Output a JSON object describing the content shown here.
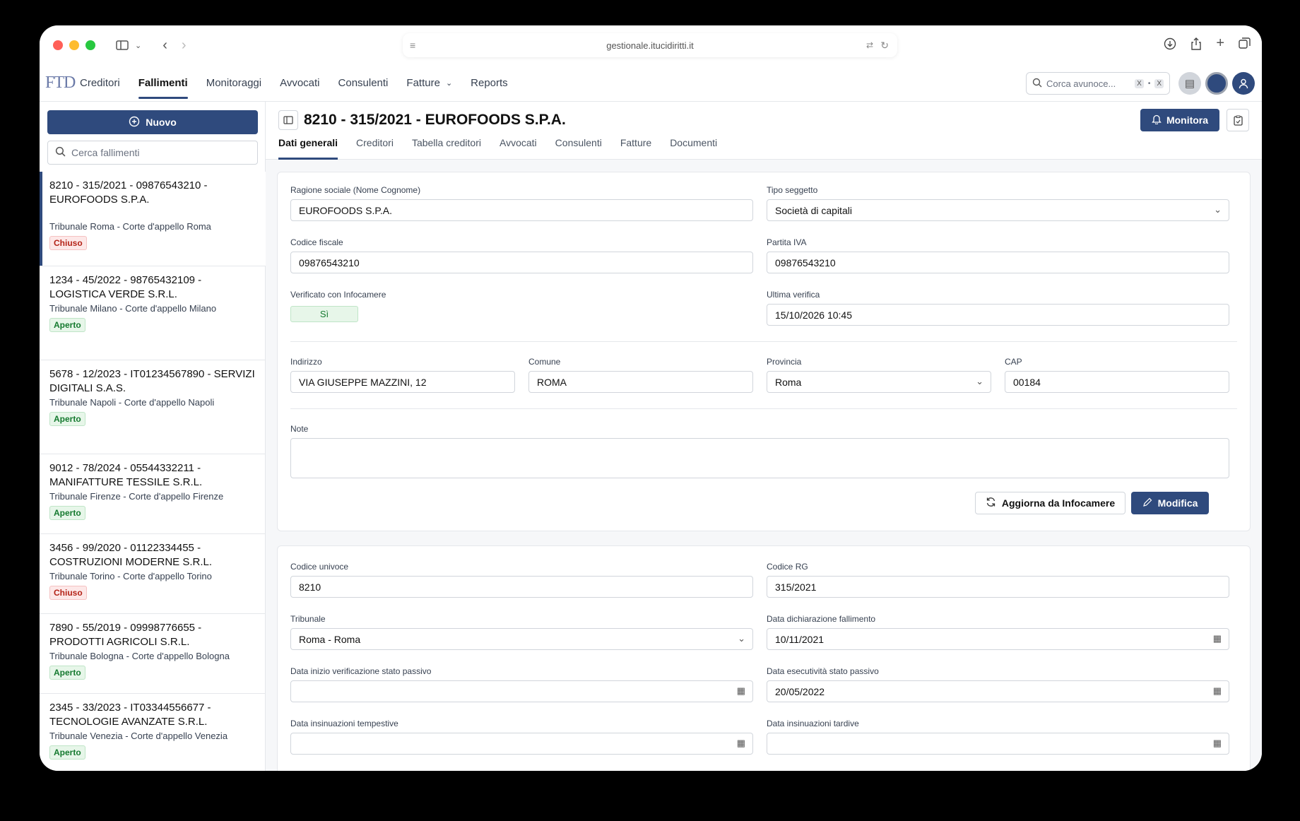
{
  "browser": {
    "url": "gestionale.itucidiritti.it"
  },
  "app": {
    "logo": "FTD",
    "nav": [
      {
        "label": "Creditori"
      },
      {
        "label": "Fallimenti"
      },
      {
        "label": "Monitoraggi"
      },
      {
        "label": "Avvocati"
      },
      {
        "label": "Consulenti"
      },
      {
        "label": "Fatture"
      },
      {
        "label": "Reports"
      }
    ],
    "search_placeholder": "Corca avunoce...",
    "search_kbd1": "X",
    "search_kbd_sep": "•",
    "search_kbd2": "X",
    "accent_color": "#2f4a7d"
  },
  "sidebar": {
    "new_button": "Nuovo",
    "search_placeholder": "Cerca fallimenti",
    "items": [
      {
        "title": "8210 - 315/2021 - 09876543210 - EUROFOODS S.P.A.",
        "court": "Tribunale Roma - Corte d'appello Roma",
        "status": "Chiuso"
      },
      {
        "title": "1234 - 45/2022 - 98765432109 - LOGISTICA VERDE S.R.L.",
        "court": "Tribunale Milano - Corte d'appello Milano",
        "status": "Aperto"
      },
      {
        "title": "5678 - 12/2023 - IT01234567890 - SERVIZI DIGITALI S.A.S.",
        "court": "Tribunale Napoli - Corte d'appello Napoli",
        "status": "Aperto"
      },
      {
        "title": "9012 - 78/2024 - 05544332211 - MANIFATTURE TESSILE S.R.L.",
        "court": "Tribunale Firenze - Corte d'appello Firenze",
        "status": "Aperto"
      },
      {
        "title": "3456 - 99/2020 - 01122334455 - COSTRUZIONI MODERNE S.R.L.",
        "court": "Tribunale Torino - Corte d'appello Torino",
        "status": "Chiuso"
      },
      {
        "title": "7890 - 55/2019 - 09998776655 - PRODOTTI AGRICOLI S.R.L.",
        "court": "Tribunale Bologna - Corte d'appello Bologna",
        "status": "Aperto"
      },
      {
        "title": "2345 - 33/2023 - IT03344556677 - TECNOLOGIE AVANZATE S.R.L.",
        "court": "Tribunale Venezia - Corte d'appello Venezia",
        "status": "Aperto"
      }
    ]
  },
  "main": {
    "title": "8210 - 315/2021 - EUROFOODS S.P.A.",
    "monitor_button": "Monitora",
    "tabs": [
      {
        "label": "Dati generali"
      },
      {
        "label": "Creditori"
      },
      {
        "label": "Tabella creditori"
      },
      {
        "label": "Avvocati"
      },
      {
        "label": "Consulenti"
      },
      {
        "label": "Fatture"
      },
      {
        "label": "Documenti"
      }
    ],
    "general": {
      "ragione_label": "Ragione sociale (Nome Cognome)",
      "ragione_value": "EUROFOODS S.P.A.",
      "tipo_label": "Tipo seggetto",
      "tipo_value": "Società di capitali",
      "cf_label": "Codice fiscale",
      "cf_value": "09876543210",
      "piva_label": "Partita IVA",
      "piva_value": "09876543210",
      "verif_label": "Verificato con Infocamere",
      "verif_value": "Sì",
      "ultima_label": "Ultima verifica",
      "ultima_value": "15/10/2026 10:45",
      "indirizzo_label": "Indirizzo",
      "indirizzo_value": "VIA GIUSEPPE MAZZINI, 12",
      "comune_label": "Comune",
      "comune_value": "ROMA",
      "provincia_label": "Provincia",
      "provincia_value": "Roma",
      "cap_label": "CAP",
      "cap_value": "00184",
      "note_label": "Note",
      "note_value": "",
      "refresh_button": "Aggiorna da Infocamere",
      "edit_button": "Modifica"
    },
    "procedure": {
      "cod_univ_label": "Codice univoce",
      "cod_univ_value": "8210",
      "cod_rg_label": "Codice RG",
      "cod_rg_value": "315/2021",
      "tribunale_label": "Tribunale",
      "tribunale_value": "Roma - Roma",
      "data_dich_label": "Data dichiarazione fallimento",
      "data_dich_value": "10/11/2021",
      "data_inizio_label": "Data inizio verificazione stato passivo",
      "data_inizio_value": "",
      "data_esec_label": "Data esecutività stato passivo",
      "data_esec_value": "20/05/2022",
      "ins_temp_label": "Data insinuazioni tempestive",
      "ins_temp_value": "",
      "ins_tard_label": "Data insinuazioni tardive",
      "ins_tard_value": ""
    }
  }
}
